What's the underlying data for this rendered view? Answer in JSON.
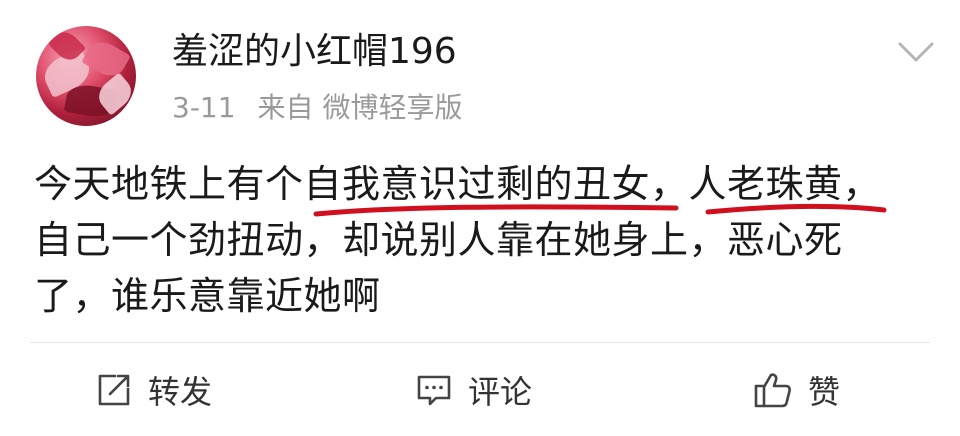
{
  "post": {
    "username": "羞涩的小红帽196",
    "date": "3-11",
    "source": "来自 微博轻享版",
    "content_lines": [
      "今天地铁上有个自我意识过剩的丑女，人老珠黄，",
      "自己一个劲扭动，却说别人靠在她身上，恶心死",
      "了，谁乐意靠近她啊"
    ],
    "underline_color": "#d0101e"
  },
  "actions": {
    "repost_label": "转发",
    "comment_label": "评论",
    "like_label": "赞"
  },
  "icons": {
    "avatar": "avatar-image",
    "more": "chevron-down-icon",
    "repost": "repost-icon",
    "comment": "comment-icon",
    "like": "thumbs-up-icon"
  }
}
